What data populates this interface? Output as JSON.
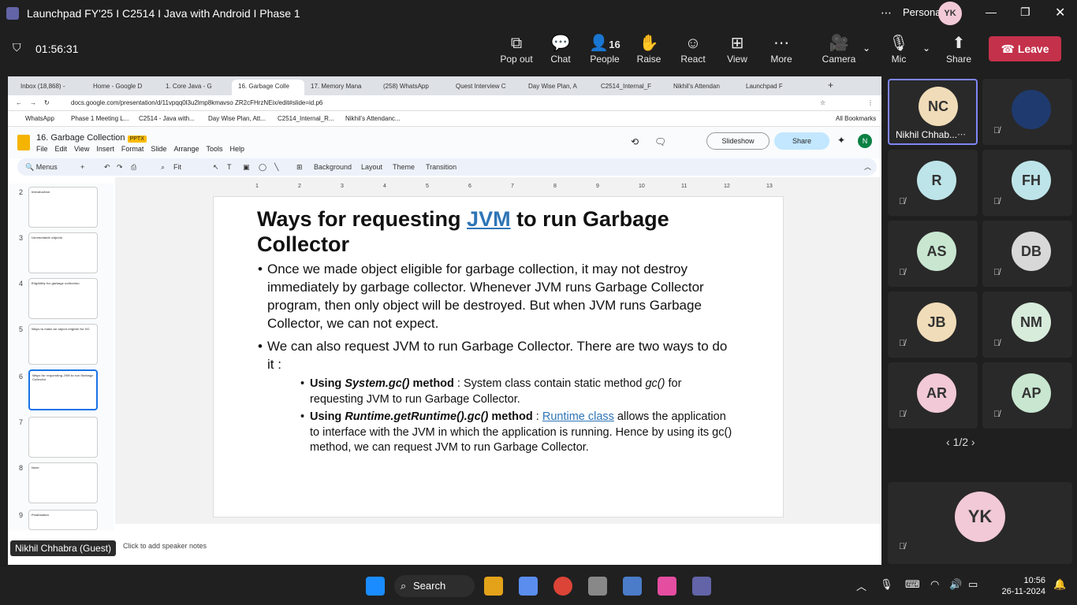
{
  "window": {
    "title": "Launchpad FY'25 I C2514 I Java with Android I Phase 1",
    "account": "Personal",
    "avatar": "YK"
  },
  "meeting": {
    "timer": "01:56:31",
    "controls": [
      {
        "label": "Pop out",
        "icon": "popout-icon"
      },
      {
        "label": "Chat",
        "icon": "chat-icon"
      },
      {
        "label": "People",
        "icon": "people-icon",
        "count": "16"
      },
      {
        "label": "Raise",
        "icon": "hand-icon"
      },
      {
        "label": "React",
        "icon": "smile-icon"
      },
      {
        "label": "View",
        "icon": "grid-icon"
      },
      {
        "label": "More",
        "icon": "more-icon"
      },
      {
        "label": "Camera",
        "icon": "camera-off-icon"
      },
      {
        "label": "Mic",
        "icon": "mic-off-icon"
      },
      {
        "label": "Share",
        "icon": "share-icon"
      }
    ],
    "leave": "Leave"
  },
  "browser": {
    "tabs": [
      "Inbox (18,868) -",
      "Home - Google D",
      "1. Core Java - G",
      "16. Garbage Colle",
      "17. Memory Mana",
      "(258) WhatsApp",
      "Quest Interview C",
      "Day Wise Plan, A",
      "C2514_Internal_F",
      "Nikhil's Attendan",
      "Launchpad F"
    ],
    "url": "docs.google.com/presentation/d/11vpqq0l3u2lmp8kmavso ZR2cFHrzNEix/edit#slide=id.p6",
    "bookmarks": [
      "WhatsApp",
      "Phase 1 Meeting L...",
      "C2514 - Java with...",
      "Day Wise Plan, Att...",
      "C2514_Internal_R...",
      "Nikhil's Attendanc...",
      "All Bookmarks"
    ]
  },
  "doc": {
    "title": "16. Garbage Collection",
    "badge": "PPTX",
    "menus": [
      "File",
      "Edit",
      "View",
      "Insert",
      "Format",
      "Slide",
      "Arrange",
      "Tools",
      "Help"
    ],
    "slideshow": "Slideshow",
    "share": "Share",
    "user": "N",
    "toolbar": {
      "menus": "Menus",
      "zoom": "Fit",
      "background": "Background",
      "layout": "Layout",
      "theme": "Theme",
      "transition": "Transition"
    }
  },
  "ruler": [
    "1",
    "2",
    "3",
    "4",
    "5",
    "6",
    "7",
    "8",
    "9",
    "10",
    "11",
    "12",
    "13"
  ],
  "thumbnails": [
    {
      "num": "2",
      "title": "Introduction"
    },
    {
      "num": "3",
      "title": "Unreachable objects"
    },
    {
      "num": "4",
      "title": "Eligibility for garbage collection"
    },
    {
      "num": "5",
      "title": "Ways to make an object eligible for GC"
    },
    {
      "num": "6",
      "title": "Ways for requesting JVM to run Garbage Collector"
    },
    {
      "num": "7",
      "title": ""
    },
    {
      "num": "8",
      "title": "Note:"
    },
    {
      "num": "9",
      "title": "Finalization"
    }
  ],
  "slide": {
    "title_pre": "Ways for requesting ",
    "title_link": "JVM",
    "title_post": " to run Garbage Collector",
    "bullet1": "Once we made object eligible for garbage collection, it may not destroy immediately by garbage collector. Whenever JVM runs Garbage Collector program, then only object will be destroyed. But when JVM runs Garbage Collector, we can not expect.",
    "bullet2": "We can also request JVM to run Garbage Collector. There are two ways to do it :",
    "sub1_bold": "Using ",
    "sub1_code": "System.gc()",
    "sub1_bold2": " method",
    "sub1_text": " : System class contain static method ",
    "sub1_code2": "gc()",
    "sub1_text2": " for requesting JVM to run Garbage Collector.",
    "sub2_bold": "Using ",
    "sub2_code": "Runtime.getRuntime().gc()",
    "sub2_bold2": " method",
    "sub2_text": " : ",
    "sub2_link": "Runtime class",
    "sub2_text2": " allows the application to interface with the JVM in which the application is running. Hence by using its gc() method, we can request JVM to run Garbage Collector."
  },
  "notes": "Click to add speaker notes",
  "presenter_label": "Nikhil Chhabra (Guest)",
  "participants": [
    {
      "initials": "NC",
      "name": "Nikhil Chhab...",
      "color": "#f0dcb8",
      "speaking": true
    },
    {
      "initials": "",
      "name": "",
      "color": "#1f3a6e"
    },
    {
      "initials": "R",
      "color": "#bde4e8"
    },
    {
      "initials": "FH",
      "color": "#bde4e8"
    },
    {
      "initials": "AS",
      "color": "#c8e6d0"
    },
    {
      "initials": "DB",
      "color": "#d8d8d8"
    },
    {
      "initials": "JB",
      "color": "#f0dcb8"
    },
    {
      "initials": "NM",
      "color": "#d8ecdc"
    },
    {
      "initials": "AR",
      "color": "#f2c9d6"
    },
    {
      "initials": "AP",
      "color": "#c8e6d0"
    }
  ],
  "pager": "1/2",
  "self": {
    "initials": "YK",
    "color": "#f2c9d6"
  },
  "taskbar": {
    "search": "Search",
    "time": "10:56",
    "date": "26-11-2024"
  }
}
